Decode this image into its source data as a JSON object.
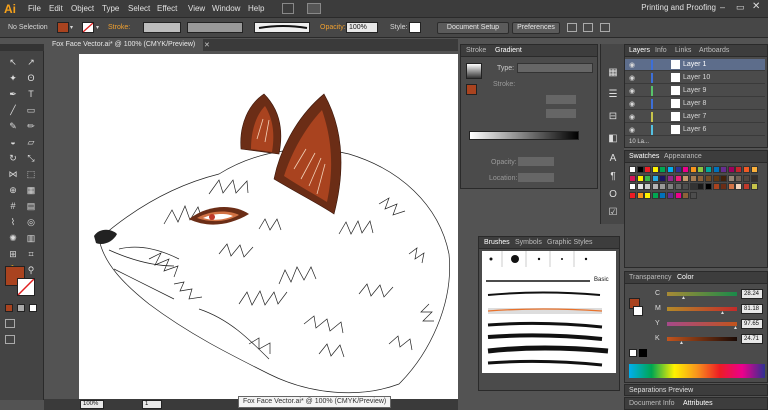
{
  "menubar": {
    "logo": "Ai",
    "items": [
      "File",
      "Edit",
      "Object",
      "Type",
      "Select",
      "Effect",
      "View",
      "Window",
      "Help"
    ],
    "workspace": "Printing and Proofing"
  },
  "controlbar": {
    "selection": "No Selection",
    "stroke_label": "Stroke:",
    "opacity_label": "Opacity:",
    "opacity_value": "100%",
    "style_label": "Style:",
    "document_setup": "Document Setup",
    "preferences": "Preferences"
  },
  "document": {
    "tab": "Fox Face Vector.ai* @ 100% (CMYK/Preview)",
    "zoom": "100%",
    "page": "1",
    "tooltip": "Fox Face Vector.ai* @ 100% (CMYK/Preview)"
  },
  "stroke_panel": {
    "tabs": [
      "Stroke",
      "Gradient"
    ],
    "type_label": "Type:",
    "stroke_label": "Stroke:",
    "opacity_label": "Opacity:",
    "location_label": "Location:"
  },
  "brushes_panel": {
    "tabs": [
      "Brushes",
      "Symbols",
      "Graphic Styles"
    ],
    "basic_label": "Basic"
  },
  "layers_panel": {
    "tabs": [
      "Layers",
      "Info",
      "Links",
      "Artboards"
    ],
    "layers": [
      {
        "name": "Layer 1",
        "color": "#3d6fd8"
      },
      {
        "name": "Layer 10",
        "color": "#3d6fd8"
      },
      {
        "name": "Layer 9",
        "color": "#58c26a"
      },
      {
        "name": "Layer 8",
        "color": "#3d6fd8"
      },
      {
        "name": "Layer 7",
        "color": "#c6c34a"
      },
      {
        "name": "Layer 6",
        "color": "#54c0e0"
      }
    ],
    "count": "10 La..."
  },
  "swatches_panel": {
    "tabs": [
      "Swatches",
      "Appearance"
    ]
  },
  "color_panel": {
    "tabs": [
      "Transparency",
      "Color"
    ],
    "channels": [
      {
        "label": "C",
        "value": "28.24",
        "level": 0.2824
      },
      {
        "label": "M",
        "value": "81.18",
        "level": 0.8118
      },
      {
        "label": "Y",
        "value": "97.65",
        "level": 0.9765
      },
      {
        "label": "K",
        "value": "24.71",
        "level": 0.2471
      }
    ]
  },
  "separations": {
    "title": "Separations Preview"
  },
  "bottom_tabs": [
    "Document Info",
    "Attributes"
  ],
  "colors": {
    "fill": "#a9431f",
    "fox_dark": "#6b2d16",
    "fox_mid": "#a9431f"
  }
}
